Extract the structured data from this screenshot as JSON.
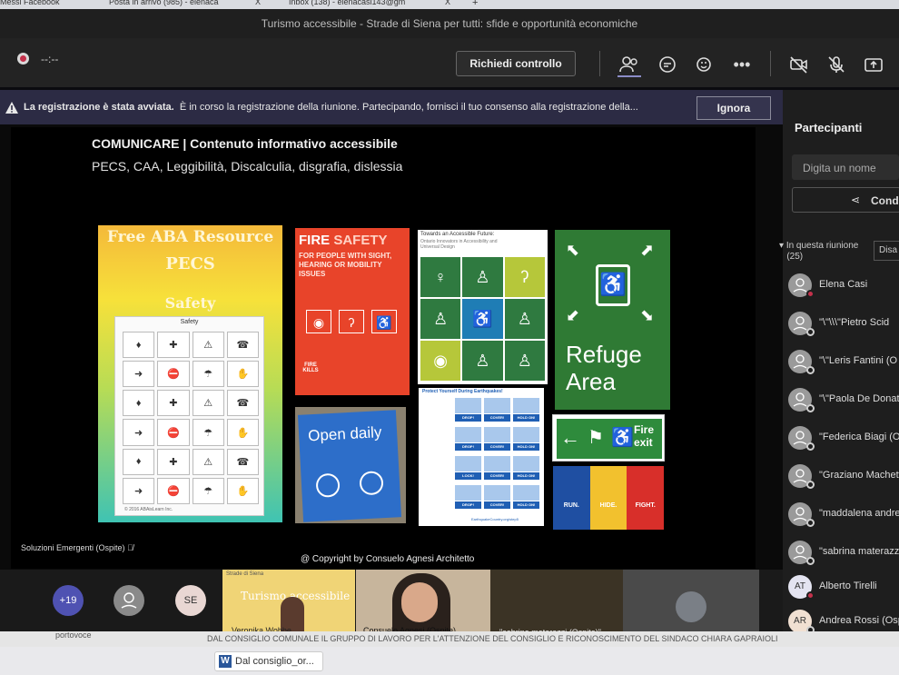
{
  "browser": {
    "tabs": [
      "Messi Facebook",
      "Posta in arrivo (985) - elenaca",
      "Inbox (138) - elenacasi143@gm",
      "+"
    ],
    "tab_close": "X"
  },
  "meeting": {
    "title": "Turismo accessibile - Strade di Siena per tutti: sfide e opportunità economiche",
    "timer": "--:--",
    "request_control_label": "Richiedi controllo"
  },
  "banner": {
    "bold": "La registrazione è stata avviata.",
    "text": "È in corso la registrazione della riunione. Partecipando, fornisci il tuo consenso alla registrazione della...",
    "ignore_label": "Ignora"
  },
  "slide": {
    "title": "COMUNICARE | Contenuto informativo accessibile",
    "subtitle": "PECS, CAA, Leggibilità, Discalculia, disgrafia, dislessia",
    "copyright": "@ Copyright by Consuelo Agnesi Architetto",
    "presenter": "Soluzioni Emergenti (Ospite)",
    "pecs": {
      "line1": "Free ABA Resource",
      "line2": "PECS",
      "line3": "Safety",
      "card_title": "Safety",
      "footer": "© 2016 ABAisLearn Inc."
    },
    "fire": {
      "fire": "FIRE",
      "safety": "SAFETY",
      "body": "FOR PEOPLE WITH SIGHT, HEARING OR MOBILITY ISSUES",
      "logo_top": "FIRE",
      "logo_bottom": "KILLS"
    },
    "ontario": {
      "line1": "Towards an Accessible Future:",
      "line2": "Ontario Innovators in Accessibility and Universal Design"
    },
    "refuge": {
      "line1": "Refuge",
      "line2": "Area"
    },
    "open_daily": "Open daily",
    "quake": {
      "title": "Protect Yourself During Earthquakes!",
      "drop": "DROP!",
      "cover": "COVER!",
      "hold": "HOLD ON!",
      "lock": "LOCK!",
      "footer": "EarthquakeCountry.org/step5"
    },
    "fire_exit": {
      "line1": "Fire",
      "line2": "exit"
    },
    "run_hide_fight": {
      "run": "RUN.",
      "hide": "HIDE.",
      "fight": "FIGHT."
    }
  },
  "participants": {
    "title": "Partecipanti",
    "search_placeholder": "Digita un nome",
    "share_label": "Condi",
    "section_label": "In questa riunione",
    "section_count": "(25)",
    "disattiva_label": "Disa",
    "list": [
      {
        "name": "Elena Casi",
        "initials": ""
      },
      {
        "name": "\"\\\"\\\\\\\"Pietro Scid",
        "initials": ""
      },
      {
        "name": "\"\\\"Leris Fantini (O",
        "initials": ""
      },
      {
        "name": "\"\\\"Paola De Donat",
        "initials": ""
      },
      {
        "name": "\"Federica Biagi (Os",
        "initials": ""
      },
      {
        "name": "\"Graziano Machett",
        "initials": ""
      },
      {
        "name": "\"maddalena andrei",
        "initials": ""
      },
      {
        "name": "\"sabrina materazzi (",
        "initials": ""
      },
      {
        "name": "Alberto Tirelli",
        "initials": "AT"
      },
      {
        "name": "Andrea Rossi (Ospite",
        "initials": "AR"
      }
    ]
  },
  "video_strip": {
    "more_count": "+19",
    "se_initials": "SE",
    "tile1_name": "Veronika Wobbe",
    "tile1_slide_text": "Turismo accessibile",
    "tile1_logo_text": "Strade di Siena",
    "tile2_name": "Consuelo Agnesi (Ospite)",
    "tile3_name": "\"sabrina materazzi (Ospite)\""
  },
  "taskbar": {
    "left_text": "portovoce",
    "doc_label": "Dal consiglio_or...",
    "bg_text": "DAL CONSIGLIO COMUNALE IL GRUPPO DI LAVORO PER L'ATTENZIONE DEL CONSIGLIO E RICONOSCIMENTO DEL SINDACO CHIARA GAPRAIOLI"
  },
  "colors": {
    "accent": "#6264a7",
    "banner_bg": "#2c2b44",
    "dark_bg": "#1e1e1e"
  }
}
